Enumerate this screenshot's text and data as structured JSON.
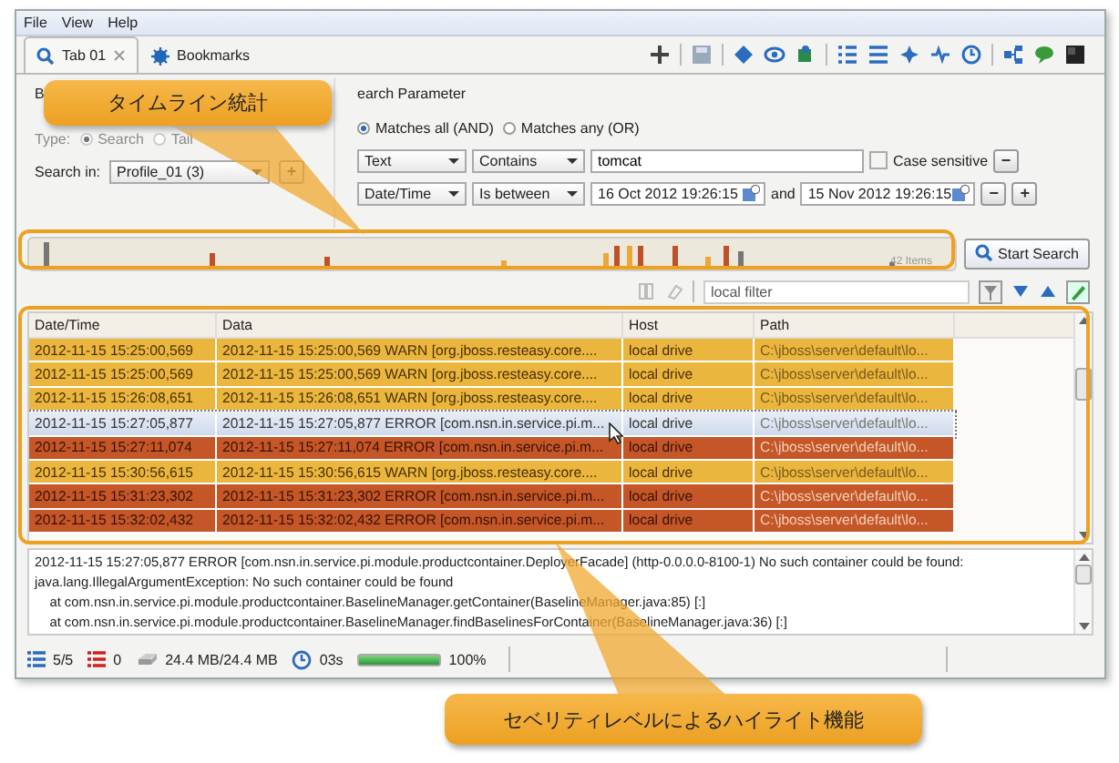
{
  "menu": [
    {
      "label": "File"
    },
    {
      "label": "View"
    },
    {
      "label": "Help"
    }
  ],
  "tabs": [
    {
      "label": "Tab 01",
      "selected": true,
      "closable": true
    },
    {
      "label": "Bookmarks",
      "selected": false,
      "closable": false
    }
  ],
  "basic": {
    "title": "B",
    "type_label": "Type:",
    "modes": [
      {
        "label": "Search",
        "selected": true
      },
      {
        "label": "Tail",
        "selected": false
      }
    ],
    "search_in_label": "Search in:",
    "profile": "Profile_01 (3)",
    "add": "+"
  },
  "params": {
    "title": "earch Parameter",
    "match": [
      {
        "label": "Matches all (AND)",
        "selected": true
      },
      {
        "label": "Matches any (OR)",
        "selected": false
      }
    ],
    "conditions": [
      {
        "kind": "text",
        "field": "Text",
        "operator": "Contains",
        "value": "tomcat",
        "case_label": "Case sensitive",
        "case_checked": false,
        "remove": "−"
      },
      {
        "kind": "range",
        "field": "Date/Time",
        "operator": "Is between",
        "from": "16 Oct 2012 19:26:15",
        "joiner": "and",
        "to": "15 Nov 2012 19:26:15",
        "remove": "−",
        "add": "+"
      }
    ]
  },
  "timeline": {
    "count": "42 Items"
  },
  "start_search": "Start Search",
  "filter": {
    "placeholder": "local filter"
  },
  "table": {
    "columns": [
      "Date/Time",
      "Data",
      "Host",
      "Path"
    ],
    "rows": [
      {
        "color": "#ebb63e",
        "selected": false,
        "cells": [
          "2012-11-15 15:25:00,569",
          "2012-11-15 15:25:00,569 WARN  [org.jboss.resteasy.core....",
          "local drive",
          "C:\\jboss\\server\\default\\lo..."
        ]
      },
      {
        "color": "#ebb63e",
        "selected": false,
        "cells": [
          "2012-11-15 15:25:00,569",
          "2012-11-15 15:25:00,569 WARN  [org.jboss.resteasy.core....",
          "local drive",
          "C:\\jboss\\server\\default\\lo..."
        ]
      },
      {
        "color": "#ebb63e",
        "selected": false,
        "cells": [
          "2012-11-15 15:26:08,651",
          "2012-11-15 15:26:08,651 WARN  [org.jboss.resteasy.core....",
          "local drive",
          "C:\\jboss\\server\\default\\lo..."
        ]
      },
      {
        "selected": true,
        "cells": [
          "2012-11-15 15:27:05,877",
          "2012-11-15 15:27:05,877 ERROR [com.nsn.in.service.pi.m...",
          "local drive",
          "C:\\jboss\\server\\default\\lo..."
        ]
      },
      {
        "color": "#c45628",
        "selected": false,
        "cells": [
          "2012-11-15 15:27:11,074",
          "2012-11-15 15:27:11,074 ERROR [com.nsn.in.service.pi.m...",
          "local drive",
          "C:\\jboss\\server\\default\\lo..."
        ]
      },
      {
        "color": "#ebb63e",
        "selected": false,
        "cells": [
          "2012-11-15 15:30:56,615",
          "2012-11-15 15:30:56,615 WARN  [org.jboss.resteasy.core....",
          "local drive",
          "C:\\jboss\\server\\default\\lo..."
        ]
      },
      {
        "color": "#c45628",
        "selected": false,
        "cells": [
          "2012-11-15 15:31:23,302",
          "2012-11-15 15:31:23,302 ERROR [com.nsn.in.service.pi.m...",
          "local drive",
          "C:\\jboss\\server\\default\\lo..."
        ]
      },
      {
        "color": "#c45628",
        "selected": false,
        "cells": [
          "2012-11-15 15:32:02,432",
          "2012-11-15 15:32:02,432 ERROR [com.nsn.in.service.pi.m...",
          "local drive",
          "C:\\jboss\\server\\default\\lo..."
        ]
      }
    ]
  },
  "details": [
    "2012-11-15 15:27:05,877 ERROR [com.nsn.in.service.pi.module.productcontainer.DeployerFacade] (http-0.0.0.0-8100-1) No such container could be found:",
    "java.lang.IllegalArgumentException: No such container could be found",
    "    at com.nsn.in.service.pi.module.productcontainer.BaselineManager.getContainer(BaselineManager.java:85) [:]",
    "    at com.nsn.in.service.pi.module.productcontainer.BaselineManager.findBaselinesForContainer(BaselineManager.java:36) [:]"
  ],
  "status": {
    "entries": "5/5",
    "errors": "0",
    "memory": "24.4 MB/24.4 MB",
    "time": "03s",
    "progress": {
      "level": 1,
      "reading": "100%"
    }
  },
  "callouts": [
    {
      "text": "タイムライン統計"
    },
    {
      "text": "セベリティレベルによるハイライト機能"
    }
  ]
}
